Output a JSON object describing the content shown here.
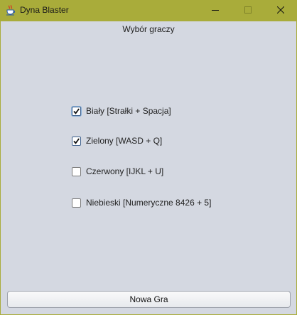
{
  "window": {
    "title": "Dyna Blaster",
    "icon": "java-cup-icon",
    "controls": [
      "minimize-icon",
      "maximize-icon",
      "close-icon"
    ],
    "titlebar_color": "#a9ac3a",
    "background_color": "#d4d8e1"
  },
  "main": {
    "heading": "Wybór graczy",
    "players": [
      {
        "label": "Biały [Strałki + Spacja]",
        "checked": true
      },
      {
        "label": "Zielony [WASD + Q]",
        "checked": true
      },
      {
        "label": "Czerwony [IJKL + U]",
        "checked": false
      },
      {
        "label": "Niebieski [Numeryczne 8426 + 5]",
        "checked": false
      }
    ],
    "new_game_label": "Nowa Gra"
  }
}
